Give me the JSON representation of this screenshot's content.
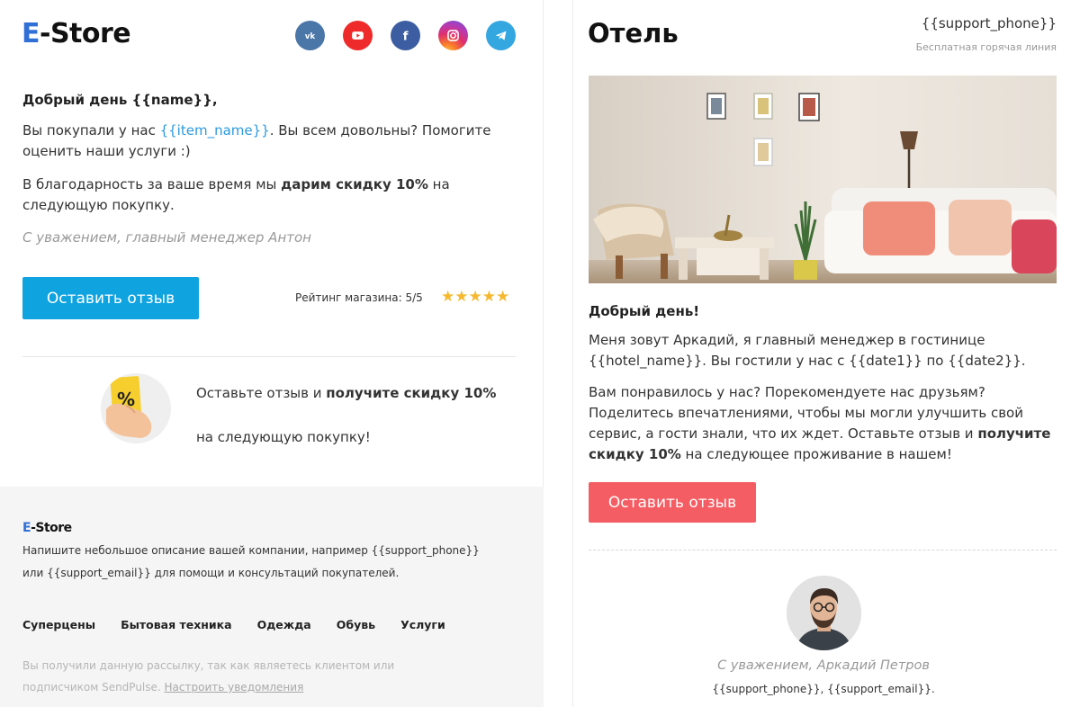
{
  "left_email": {
    "logo": {
      "e": "E",
      "rest": "-Store"
    },
    "socials": [
      {
        "name": "vk",
        "icon": "vk-icon",
        "color": "#4a76a8"
      },
      {
        "name": "youtube",
        "icon": "youtube-icon",
        "color": "#ee2a2a"
      },
      {
        "name": "facebook",
        "icon": "facebook-icon",
        "color": "#3c5da1"
      },
      {
        "name": "instagram",
        "icon": "instagram-icon",
        "color": "#e0306a"
      },
      {
        "name": "telegram",
        "icon": "telegram-icon",
        "color": "#34a7e1"
      }
    ],
    "greeting": "Добрый день {{name}},",
    "p1_before": "Вы покупали у нас ",
    "p1_var": "{{item_name}}",
    "p1_after": ". Вы всем довольны? Помогите оценить наши услуги :)",
    "p2_before": "В благодарность за ваше время мы ",
    "p2_bold": "дарим скидку 10%",
    "p2_after": " на следующую покупку.",
    "signature": "С уважением, главный менеджер Антон",
    "review_button": "Оставить отзыв",
    "rating_label": "Рейтинг магазина: 5/5",
    "rating_value": 5,
    "rating_max": 5,
    "stars": "★★★★★",
    "promo_before": "Оставьте отзыв и ",
    "promo_bold": "получите скидку 10%",
    "promo_sub": "на следующую покупку!",
    "promo_icon_text": "%",
    "footer": {
      "logo": {
        "e": "E",
        "rest": "-Store"
      },
      "description": "Напишите небольшое описание вашей компании, например {{support_phone}} или {{support_email}} для помощи и консультаций покупателей.",
      "nav": [
        "Суперцены",
        "Бытовая техника",
        "Одежда",
        "Обувь",
        "Услуги"
      ],
      "note": "Вы получили данную рассылку, так как являетесь клиентом или подписчиком SendPulse. ",
      "note_link": "Настроить уведомления"
    }
  },
  "right_email": {
    "title": "Отель",
    "phone": "{{support_phone}}",
    "hotline": "Бесплатная горячая линия",
    "greeting": "Добрый день!",
    "p1": "Меня зовут Аркадий, я главный менеджер в гостинице {{hotel_name}}. Вы гостили у нас с {{date1}} по {{date2}}.",
    "p2_before": "Вам понравилось у нас? Порекомендуете нас друзьям? Поделитесь впечатлениями, чтобы мы могли улучшить свой сервис, а гости знали, что их ждет. Оставьте отзыв и ",
    "p2_bold": "получите скидку 10%",
    "p2_after": " на следующее проживание в нашем!",
    "review_button": "Оставить отзыв",
    "signature": "С уважением, Аркадий Петров",
    "contacts": "{{support_phone}}, {{support_email}}."
  },
  "colors": {
    "accent_blue": "#0fa3e0",
    "accent_red": "#f45d63",
    "link_blue": "#2b9adf",
    "star": "#f5b82e",
    "logo_e": "#2f6fd6"
  }
}
